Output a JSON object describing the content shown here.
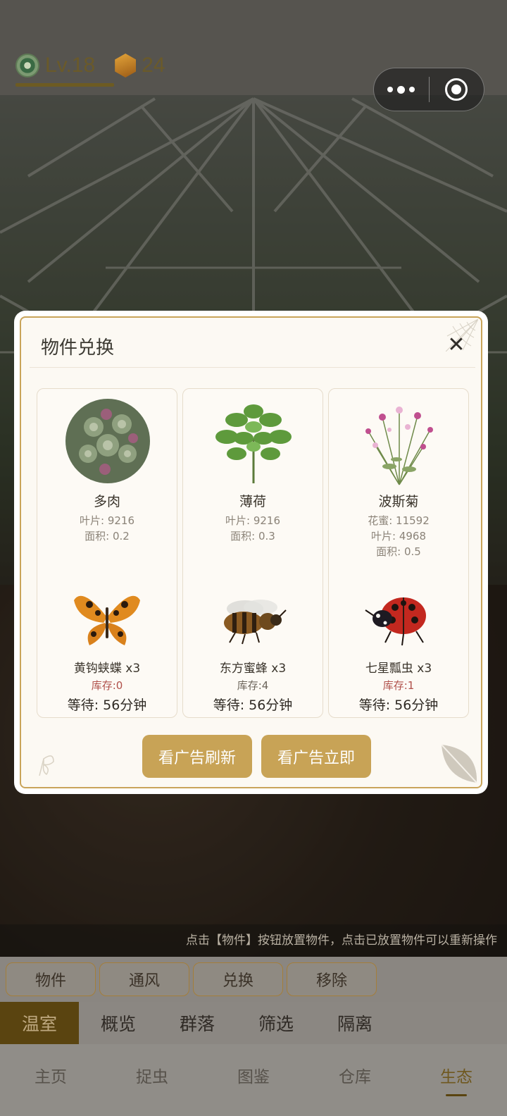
{
  "hud": {
    "level": "Lv.18",
    "coins": "24"
  },
  "hint": "点击【物件】按钮放置物件，点击已放置物件可以重新操作",
  "toolbar": [
    "物件",
    "通风",
    "兑换",
    "移除"
  ],
  "subnav": {
    "items": [
      "温室",
      "概览",
      "群落",
      "筛选",
      "隔离"
    ],
    "active": "温室"
  },
  "bottomnav": {
    "items": [
      "主页",
      "捉虫",
      "图鉴",
      "仓库",
      "生态"
    ],
    "active": "生态"
  },
  "modal": {
    "title": "物件兑换",
    "close_label": "✕",
    "cards": [
      {
        "plant": {
          "name": "多肉",
          "stats": [
            "叶片: 9216",
            "面积: 0.2"
          ],
          "icon": "succulent-icon"
        },
        "insect": {
          "name": "黄钩蛱蝶 x3",
          "stock": "库存:0",
          "wait": "等待: 56分钟",
          "icon": "butterfly-icon"
        }
      },
      {
        "plant": {
          "name": "薄荷",
          "stats": [
            "叶片: 9216",
            "面积: 0.3"
          ],
          "icon": "mint-icon"
        },
        "insect": {
          "name": "东方蜜蜂 x3",
          "stock": "库存:4",
          "wait": "等待: 56分钟",
          "icon": "bee-icon"
        }
      },
      {
        "plant": {
          "name": "波斯菊",
          "stats": [
            "花蜜: 11592",
            "叶片: 4968",
            "面积: 0.5"
          ],
          "icon": "cosmos-icon"
        },
        "insect": {
          "name": "七星瓢虫 x3",
          "stock": "库存:1",
          "wait": "等待: 56分钟",
          "icon": "ladybug-icon"
        }
      }
    ],
    "buttons": {
      "refresh": "看广告刷新",
      "instant": "看广告立即"
    }
  },
  "colors": {
    "accent": "#c8a356",
    "border": "#c9a45a",
    "stock_low": "#b0504a",
    "nav_active": "#5a4410"
  }
}
